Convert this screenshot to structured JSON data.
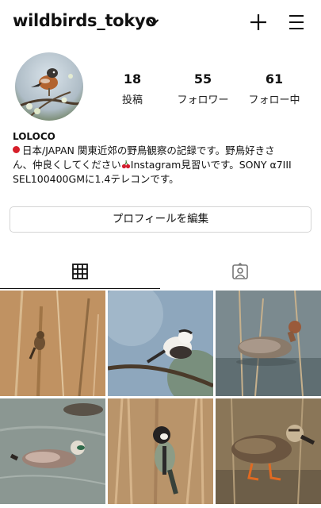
{
  "header": {
    "username": "wildbirds_tokyo",
    "icons": [
      "chevron-down-icon",
      "plus-icon",
      "menu-icon"
    ]
  },
  "profile": {
    "stats": [
      {
        "value": "18",
        "label": "投稿"
      },
      {
        "value": "55",
        "label": "フォロワー"
      },
      {
        "value": "61",
        "label": "フォロー中"
      }
    ],
    "name": "LOLOCO",
    "bio_line1": "日本/JAPAN 関東近郊の野鳥観察の記録です。野鳥好きさ",
    "bio_line2a": "ん、仲良くしてください",
    "bio_line2b": "Instagram見習いです。SONY α7III",
    "bio_line3": "SEL100400GMに1.4テレコンです。",
    "edit_button": "プロフィールを編集"
  },
  "tabs": [
    {
      "name": "posts-grid",
      "icon": "grid-icon",
      "active": true
    },
    {
      "name": "tagged",
      "icon": "tagged-person-icon",
      "active": false
    }
  ],
  "colors": {
    "accent": "#111111",
    "border": "#d4d4d4",
    "flag_red": "#d61f2a"
  }
}
